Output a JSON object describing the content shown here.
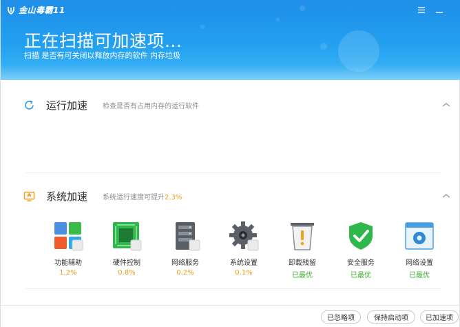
{
  "app": {
    "name": "金山毒霸11"
  },
  "header": {
    "title": "正在扫描可加速项...",
    "subtitle": "扫描 是否有可关闭以释放内存的软件 内存垃圾",
    "menu_icon": "menu-icon",
    "minimize_icon": "minimize-icon"
  },
  "sections": {
    "run": {
      "title": "运行加速",
      "desc": "检查是否有占用内存的运行软件",
      "icon": "refresh-icon"
    },
    "system": {
      "title": "系统加速",
      "desc_prefix": "系统运行速度可提升",
      "desc_pct": "2.3%",
      "icon": "speed-icon"
    }
  },
  "items": [
    {
      "label": "功能辅助",
      "value": "1.2%",
      "status": "orange",
      "icon": "features-icon"
    },
    {
      "label": "硬件控制",
      "value": "0.8%",
      "status": "orange",
      "icon": "chip-icon"
    },
    {
      "label": "网络服务",
      "value": "0.2%",
      "status": "orange",
      "icon": "server-icon"
    },
    {
      "label": "系统设置",
      "value": "0.1%",
      "status": "orange",
      "icon": "gear-icon"
    },
    {
      "label": "卸载残留",
      "value": "已最优",
      "status": "green",
      "icon": "trash-warning-icon"
    },
    {
      "label": "安全服务",
      "value": "已最优",
      "status": "green",
      "icon": "shield-check-icon"
    },
    {
      "label": "网络设置",
      "value": "已最优",
      "status": "green",
      "icon": "network-settings-icon"
    }
  ],
  "footer": {
    "ignored": "已忽略项",
    "keep_startup": "保持启动项",
    "accelerated": "已加速项"
  },
  "colors": {
    "header_blue": "#22a0f0",
    "accent_orange": "#f29a18",
    "ok_green": "#3aae2a"
  }
}
